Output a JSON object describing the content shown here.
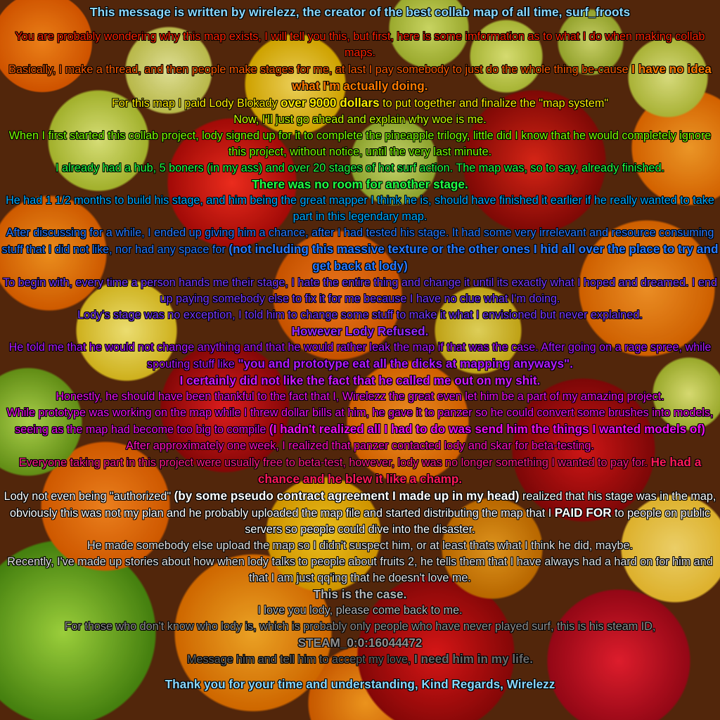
{
  "title": "This message is written by wirelezz, the creator of the best collab map of all time, surf_froots",
  "lines": {
    "l1": "You are probably wondering why this map exists, I will tell you this, but first, here is some imformation as to what I do when making collab maps.",
    "l2a": "Basically, I make a thread, and then people make stages for me, at last I pay somebody to just do the whole thing be-cause ",
    "l2b": "I have no idea what I'm actually doing.",
    "l3a": "For this map I paid Lody Blokady ",
    "l3b": "over 9000 dollars",
    "l3c": " to put together and finalize the \"map system\"",
    "l4": "Now, I'll just go ahead and explain why woe is me.",
    "l5": "When I first started this collab project, lody signed up for it to complete the pineapple trilogy, little did I know that he would completely ignore this project, without notice, until the very last minute.",
    "l6": "I already had a hub, 5 boners (in my ass) and over 20 stages of hot surf action. The map was, so to say, already finished.",
    "l7": "There was no room for another stage.",
    "l8": "He had 1 1/2 months to build his stage, and him being the great mapper I think he is, should have finished it earlier if he really wanted to take part in this legendary map.",
    "l9a": "After discussing for a while, I ended up giving him a chance, after I had tested his stage. It had some very irrelevant and resource consuming stuff that I did not like, nor had any space for ",
    "l9b": "(not including this massive texture or the other ones I hid all over the place to try and get back at lody)",
    "l10": "To begin with, every time a person hands me their stage, I hate the entire thing and change it until its exactly what I hoped and dreamed. I end up paying somebody else to fix it for me because I have no clue what I'm doing.",
    "l11": "Lody's stage was no exception, I told him to change some stuff to make it what I envisioned but never explained.",
    "l12": "However Lody Refused.",
    "l13a": "He told me that he would not change anything and that he would rather leak the map if that was the case. After going on a rage spree, while spouting stuff like ",
    "l13b": "\"you and prototype eat all the dicks at mapping anyways\".",
    "l14": "I certainly did not like the fact that he called me out on my shit.",
    "l15": "Honestly, he should have been thankful to the fact that I, Wirelezz the great even let him be a part of my amazing project.",
    "l16a": "While prototype was working on the map while I threw dollar bills at him, he gave it to panzer so he could convert some brushes into models, seeing as the map had become too big to compile ",
    "l16b": "(I hadn't realized all I had to do was send him the things I wanted models of)",
    "l17": "After approximately one week, I realized that panzer contacted lody and skar for beta-testing.",
    "l18a": "Everyone taking part in this project were usually free to beta-test, however, lody was no longer something I wanted to pay for. ",
    "l18b": "He had a chance and he blew it like a champ.",
    "l19a": "Lody not even being \"authorized\" ",
    "l19b": "(by some pseudo contract agreement I made up in my head)",
    "l19c": " realized that his stage was in the map, obviously this was not my plan and he probably uploaded the map file and started distributing the map that I ",
    "l19d": "PAID FOR",
    "l19e": " to people on public servers so people could dive into the disaster.",
    "l20": "He made somebody else upload the map so I didn't suspect him, or at least thats what I think he did, maybe.",
    "l21": "Recently, I've made up stories about how when lody talks to people about fruits 2, he tells them that I have always had a hard on for him and that I am just qq'ing that he doesn't love me.",
    "l22": "This is the case.",
    "l23": "I love you lody, please come back to me.",
    "l24": "For those who don't know who lody is, which is probably only people who have never played surf, this is his steam ID,",
    "l25": "STEAM_0:0:16044472",
    "l26a": "Message him and tell him to accept my love, ",
    "l26b": "I need him in my life.",
    "sign": "Thank you for your time and understanding, Kind Regards, Wirelezz"
  },
  "colors": {
    "title": "#8ad8ff",
    "orange": "#ff7a00",
    "yellow": "#ffee00",
    "green": "#22ff44",
    "blue": "#2a7bff",
    "purple": "#9a2aff",
    "magenta": "#ee10ee",
    "pink": "#ff1a8a",
    "white": "#ffffff",
    "grey": "#6a6a6a"
  }
}
